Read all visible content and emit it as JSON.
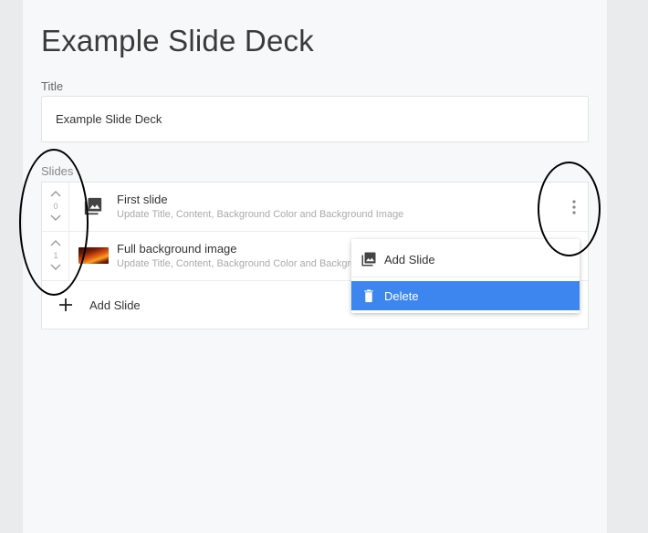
{
  "page": {
    "title": "Example Slide Deck"
  },
  "form": {
    "title_label": "Title",
    "title_value": "Example Slide Deck",
    "slides_label": "Slides"
  },
  "slides": [
    {
      "order": "0",
      "title": "First slide",
      "description": "Update Title, Content, Background Color and Background Image",
      "thumbnail": "image-icon"
    },
    {
      "order": "1",
      "title": "Full background image",
      "description": "Update Title, Content, Background Color and Background Image",
      "thumbnail": "fire-background-image"
    }
  ],
  "add_slide_label": "Add Slide",
  "context_menu": {
    "items": [
      {
        "label": "Add Slide",
        "icon": "image-library-icon",
        "highlighted": false
      },
      {
        "label": "Delete",
        "icon": "trash-icon",
        "highlighted": true
      }
    ]
  },
  "colors": {
    "accent": "#3d86f0",
    "panel": "#f7f8f9",
    "background": "#eaebec"
  }
}
